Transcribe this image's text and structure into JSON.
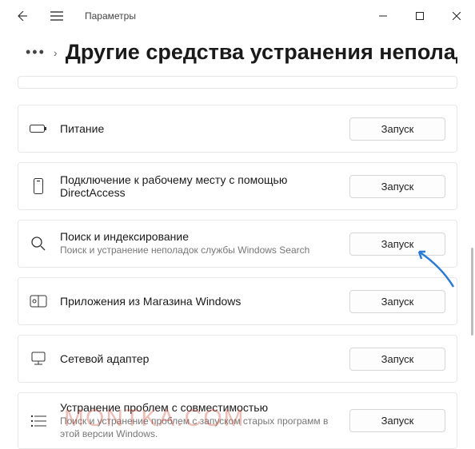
{
  "titlebar": {
    "app_name": "Параметры"
  },
  "header": {
    "dots": "•••",
    "chevron": "›",
    "title": "Другие средства устранения неполад"
  },
  "run_label": "Запуск",
  "items": [
    {
      "icon": "battery",
      "title": "Питание",
      "desc": ""
    },
    {
      "icon": "workplace",
      "title": "Подключение к рабочему месту с помощью DirectAccess",
      "desc": ""
    },
    {
      "icon": "search",
      "title": "Поиск и индексирование",
      "desc": "Поиск и устранение неполадок службы Windows Search"
    },
    {
      "icon": "store",
      "title": "Приложения из Магазина Windows",
      "desc": ""
    },
    {
      "icon": "network",
      "title": "Сетевой адаптер",
      "desc": ""
    },
    {
      "icon": "compat",
      "title": "Устранение проблем с совместимостью",
      "desc": "Поиск и устранение проблем с запуском старых программ в этой версии Windows."
    }
  ],
  "watermark": "MONTKA.COM",
  "arrow_color": "#2a7ad6"
}
